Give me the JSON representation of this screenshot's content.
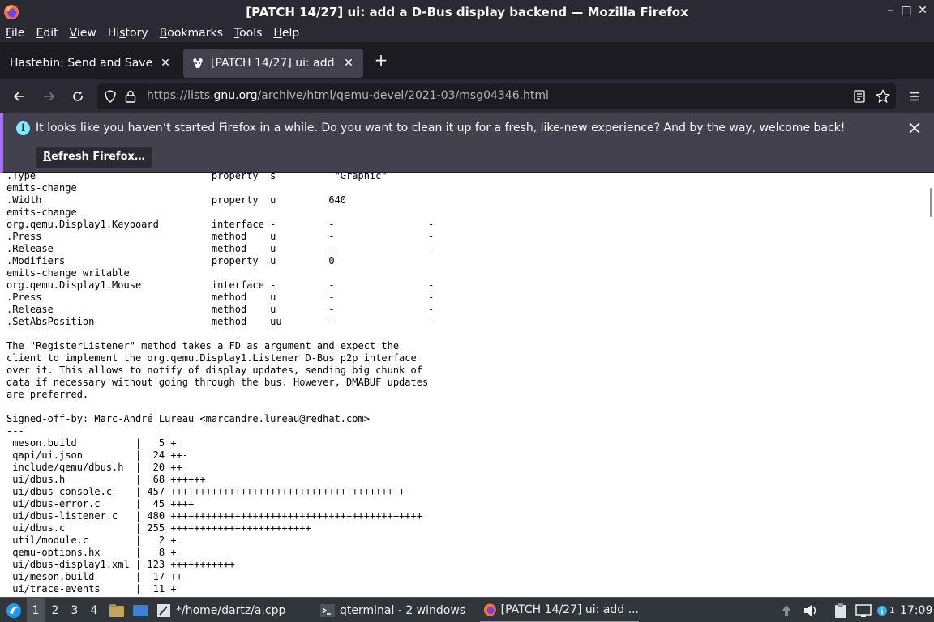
{
  "window": {
    "title": "[PATCH 14/27] ui: add a D-Bus display backend — Mozilla Firefox",
    "minimize": "–",
    "maximize": "□",
    "close": "✕"
  },
  "menu": {
    "items": [
      {
        "u": "F",
        "rest": "ile"
      },
      {
        "u": "E",
        "rest": "dit"
      },
      {
        "u": "V",
        "rest": "iew"
      },
      {
        "pre": "Hi",
        "u": "s",
        "rest": "tory"
      },
      {
        "u": "B",
        "rest": "ookmarks"
      },
      {
        "u": "T",
        "rest": "ools"
      },
      {
        "u": "H",
        "rest": "elp"
      }
    ]
  },
  "tabs": [
    {
      "label": "Hastebin: Send and Save Text",
      "close": "✕"
    },
    {
      "label": "[PATCH 14/27] ui: add a D-Bus display backend",
      "close": "✕"
    }
  ],
  "new_tab": "+",
  "address": {
    "scheme": "https://lists.",
    "host": "gnu.org",
    "path": "/archive/html/qemu-devel/2021-03/msg04346.html"
  },
  "notification": {
    "message": "It looks like you haven’t started Firefox in a while. Do you want to clean it up for a fresh, like-new experience? And by the way, welcome back!",
    "button_u": "R",
    "button_rest": "efresh Firefox…",
    "info": "i"
  },
  "content": {
    "text": ".Type                              property  s          \"Graphic\"\nemits-change\n.Width                             property  u         640\nemits-change\norg.qemu.Display1.Keyboard         interface -         -                -\n.Press                             method    u         -                -\n.Release                           method    u         -                -\n.Modifiers                         property  u         0\nemits-change writable\norg.qemu.Display1.Mouse            interface -         -                -\n.Press                             method    u         -                -\n.Release                           method    u         -                -\n.SetAbsPosition                    method    uu        -                -\n\nThe \"RegisterListener\" method takes a FD as argument and expect the\nclient to implement the org.qemu.Display1.Listener D-Bus p2p interface\nover it. This allows to notify of display updates, sending big chunk of\ndata if necessary without going through the bus. However, DMABUF updates\nare preferred.\n\nSigned-off-by: Marc-André Lureau <marcandre.lureau@redhat.com>\n---\n meson.build          |   5 +\n qapi/ui.json         |  24 ++-\n include/qemu/dbus.h  |  20 ++\n ui/dbus.h            |  68 ++++++\n ui/dbus-console.c    | 457 ++++++++++++++++++++++++++++++++++++++++\n ui/dbus-error.c      |  45 ++++\n ui/dbus-listener.c   | 480 +++++++++++++++++++++++++++++++++++++++++++\n ui/dbus.c            | 255 ++++++++++++++++++++++++\n util/module.c        |   2 +\n qemu-options.hx      |   8 +\n ui/dbus-display1.xml | 123 +++++++++++\n ui/meson.build       |  17 ++\n ui/trace-events      |  11 +"
  },
  "taskbar": {
    "workspaces": [
      "1",
      "2",
      "3",
      "4"
    ],
    "tasks": [
      {
        "label": "*/home/dartz/a.cpp"
      },
      {
        "label": "qterminal - 2 windows"
      },
      {
        "label": "[PATCH 14/27] ui: add ..."
      }
    ],
    "notification_count": "1",
    "clock": "17:09"
  },
  "colors": {
    "chrome_dark": "#2b2a33",
    "tabbar": "#1c1b22",
    "notification": "#42414d",
    "accent": "#a970ff",
    "taskbar": "#31363b"
  }
}
